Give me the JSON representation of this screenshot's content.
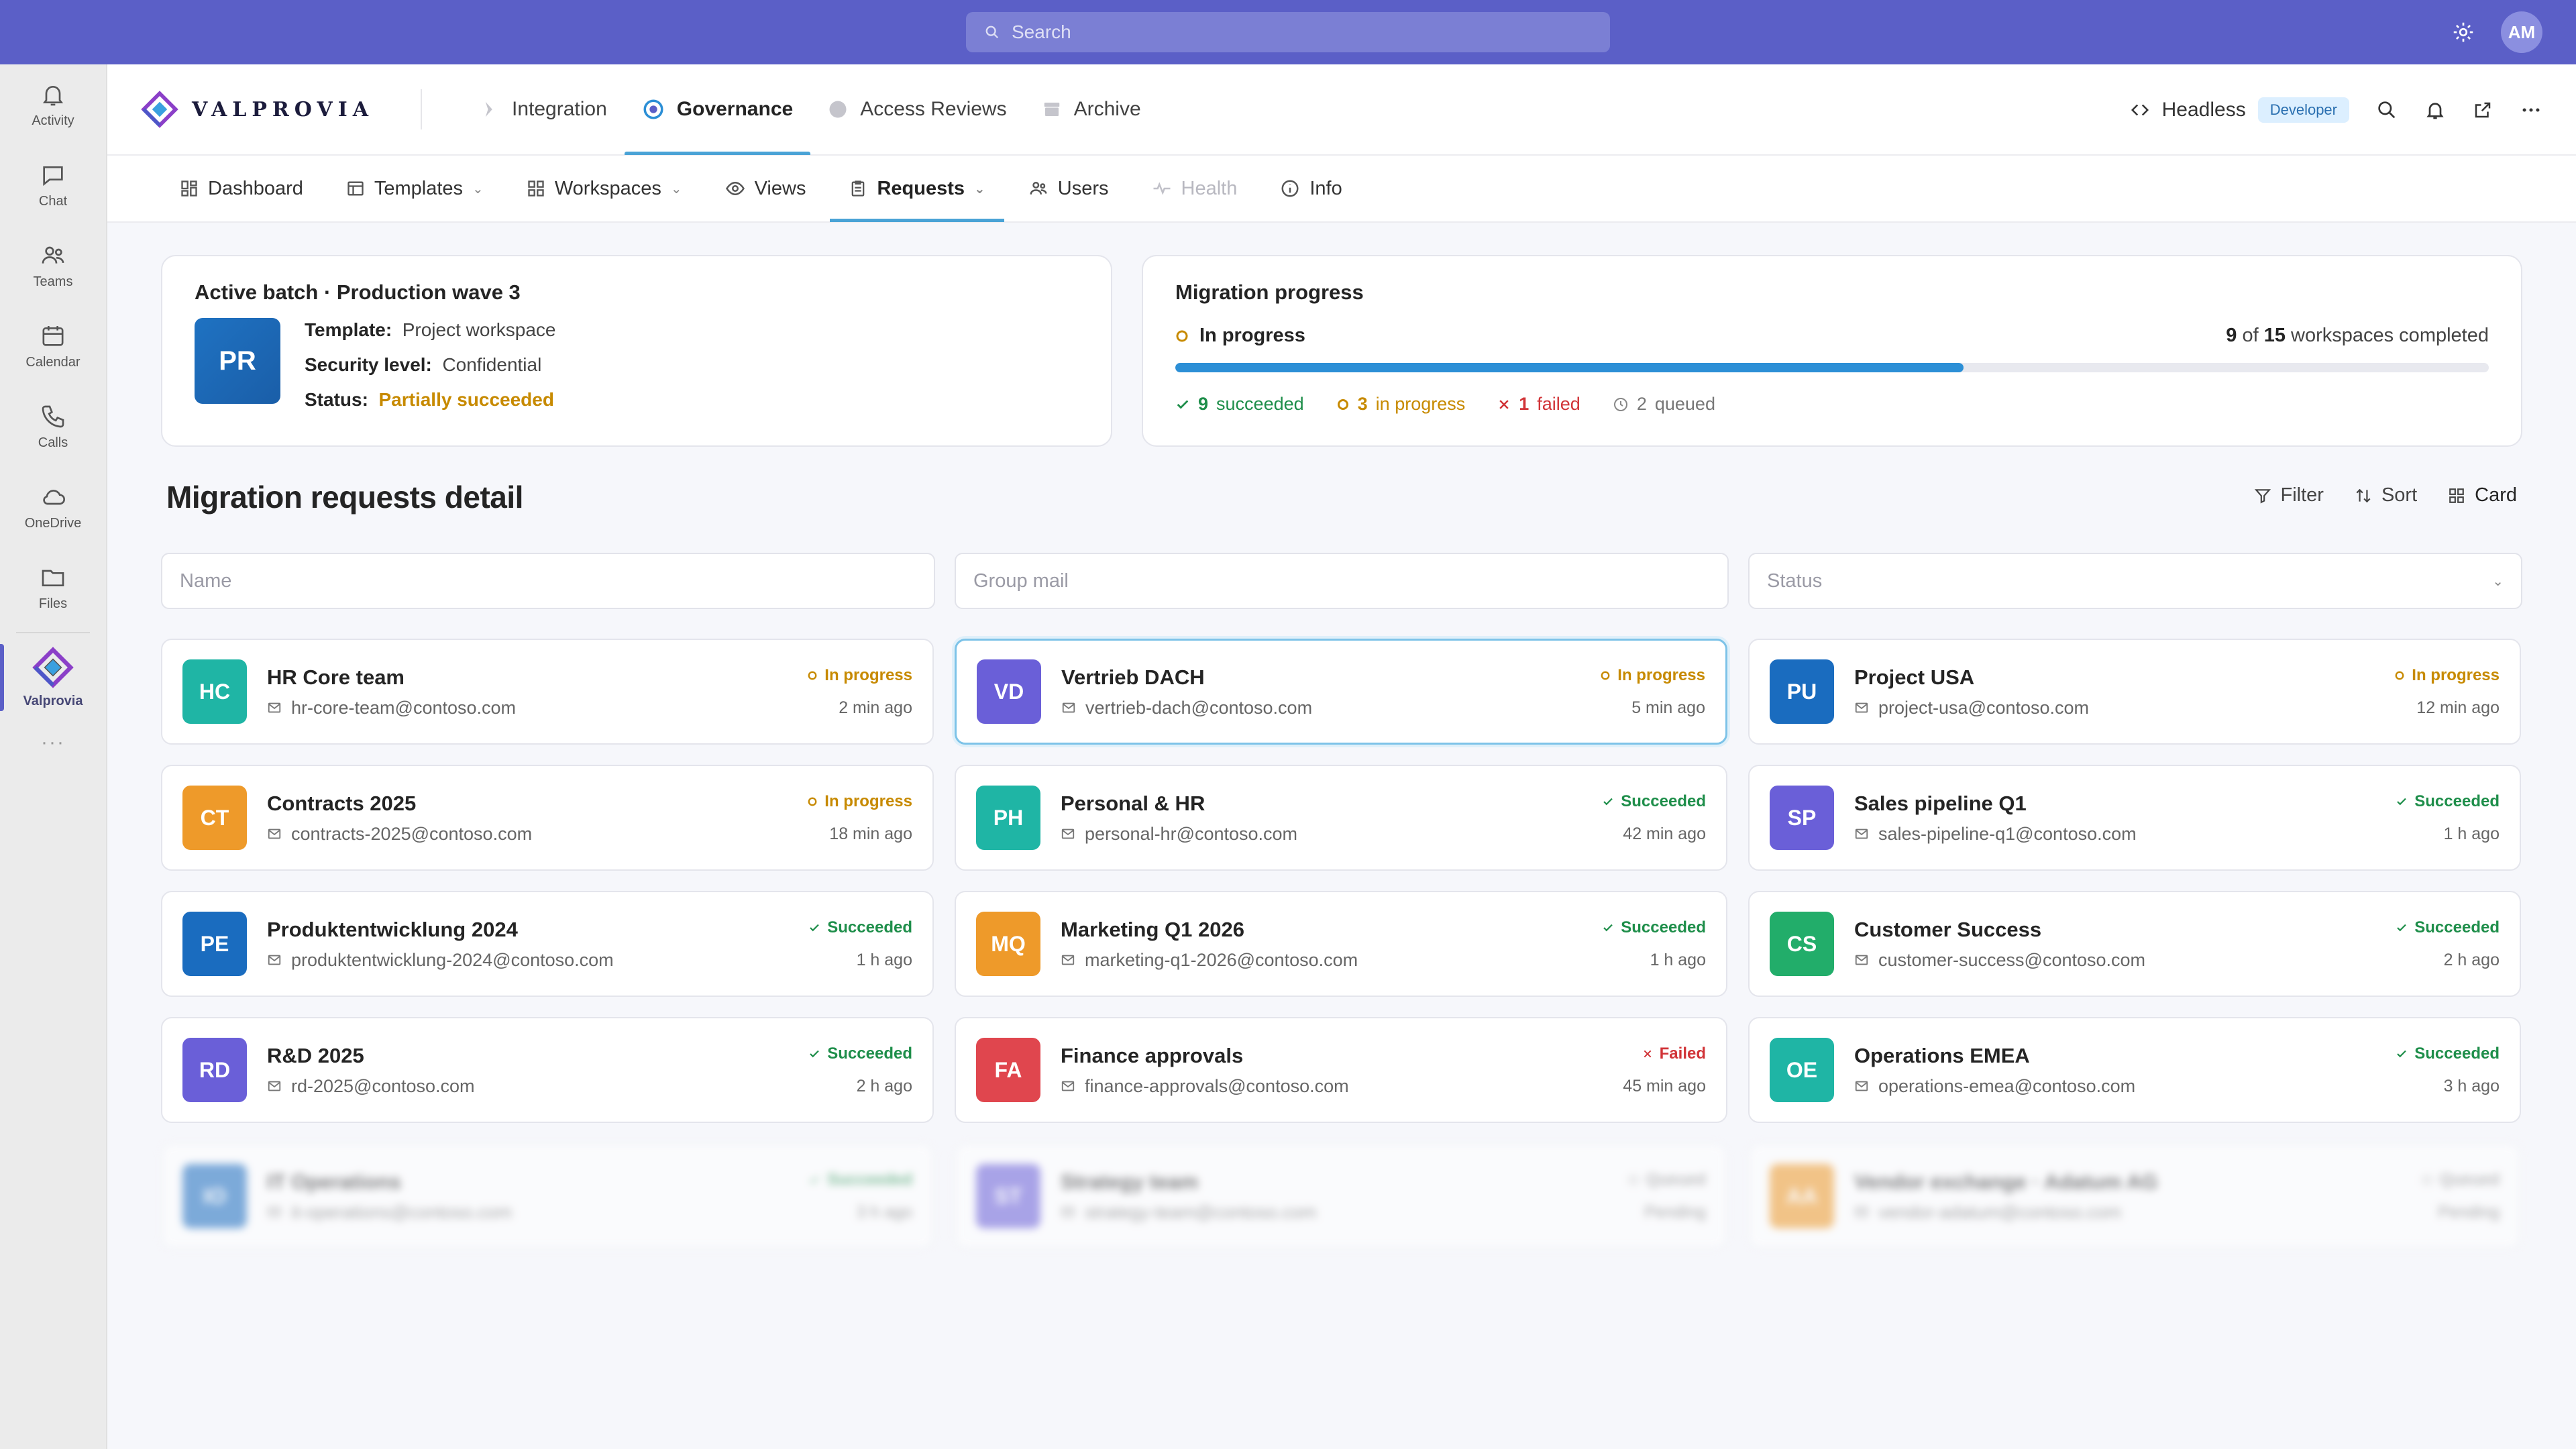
{
  "topbar": {
    "search_placeholder": "Search",
    "user_initials": "AM"
  },
  "rail": {
    "items": [
      {
        "label": "Activity",
        "icon": "bell-icon"
      },
      {
        "label": "Chat",
        "icon": "chat-icon"
      },
      {
        "label": "Teams",
        "icon": "teams-icon"
      },
      {
        "label": "Calendar",
        "icon": "calendar-icon"
      },
      {
        "label": "Calls",
        "icon": "phone-icon"
      },
      {
        "label": "OneDrive",
        "icon": "cloud-icon"
      },
      {
        "label": "Files",
        "icon": "folder-icon"
      }
    ],
    "active_app": "Valprovia",
    "more": "···"
  },
  "appbar": {
    "logo_text": "VALPROVIA",
    "tabs": [
      {
        "label": "Integration",
        "icon": "integration-icon"
      },
      {
        "label": "Governance",
        "icon": "governance-icon",
        "active": true
      },
      {
        "label": "Access Reviews",
        "icon": "shield-icon"
      },
      {
        "label": "Archive",
        "icon": "archive-icon"
      }
    ],
    "headless": "Headless",
    "developer_badge": "Developer"
  },
  "subtabs": [
    {
      "label": "Dashboard",
      "icon": "dashboard-icon"
    },
    {
      "label": "Templates",
      "icon": "templates-icon",
      "dropdown": true
    },
    {
      "label": "Workspaces",
      "icon": "workspaces-icon",
      "dropdown": true
    },
    {
      "label": "Views",
      "icon": "eye-icon"
    },
    {
      "label": "Requests",
      "icon": "clipboard-icon",
      "dropdown": true,
      "active": true
    },
    {
      "label": "Users",
      "icon": "users-icon"
    },
    {
      "label": "Health",
      "icon": "pulse-icon",
      "disabled": true
    },
    {
      "label": "Info",
      "icon": "info-icon"
    }
  ],
  "batch": {
    "title": "Active batch · Production wave 3",
    "initials": "PR",
    "template_label": "Template:",
    "template_value": "Project workspace",
    "security_label": "Security level:",
    "security_value": "Confidential",
    "status_label": "Status:",
    "status_value": "Partially succeeded"
  },
  "progress": {
    "title": "Migration progress",
    "state": "In progress",
    "completed": "9",
    "of": "of",
    "total": "15",
    "suffix": "workspaces completed",
    "fraction": 0.6,
    "succeeded_count": "9",
    "succeeded_label": "succeeded",
    "inprogress_count": "3",
    "inprogress_label": "in progress",
    "failed_count": "1",
    "failed_label": "failed",
    "queued_count": "2",
    "queued_label": "queued"
  },
  "detail": {
    "title": "Migration requests detail",
    "filter": "Filter",
    "sort": "Sort",
    "view": "Card",
    "name_placeholder": "Name",
    "mail_placeholder": "Group mail",
    "status_placeholder": "Status"
  },
  "colors": {
    "accent": "#5b5fc7",
    "in_progress": "#c78a00",
    "succeeded": "#1e8e4a",
    "failed": "#d13438"
  },
  "requests": [
    {
      "initials": "HC",
      "name": "HR Core team",
      "mail": "hr-core-team@contoso.com",
      "status": "In progress",
      "kind": "inprogress",
      "time": "2 min ago",
      "color": "#1fb5a5"
    },
    {
      "initials": "VD",
      "name": "Vertrieb DACH",
      "mail": "vertrieb-dach@contoso.com",
      "status": "In progress",
      "kind": "inprogress",
      "time": "5 min ago",
      "color": "#6a5fd8"
    },
    {
      "initials": "PU",
      "name": "Project USA",
      "mail": "project-usa@contoso.com",
      "status": "In progress",
      "kind": "inprogress",
      "time": "12 min ago",
      "color": "#1a6cbf"
    },
    {
      "initials": "CT",
      "name": "Contracts 2025",
      "mail": "contracts-2025@contoso.com",
      "status": "In progress",
      "kind": "inprogress",
      "time": "18 min ago",
      "color": "#ee9a2a"
    },
    {
      "initials": "PH",
      "name": "Personal & HR",
      "mail": "personal-hr@contoso.com",
      "status": "Succeeded",
      "kind": "succeeded",
      "time": "42 min ago",
      "color": "#1fb5a5"
    },
    {
      "initials": "SP",
      "name": "Sales pipeline Q1",
      "mail": "sales-pipeline-q1@contoso.com",
      "status": "Succeeded",
      "kind": "succeeded",
      "time": "1 h ago",
      "color": "#6a5fd8"
    },
    {
      "initials": "PE",
      "name": "Produktentwicklung 2024",
      "mail": "produktentwicklung-2024@contoso.com",
      "status": "Succeeded",
      "kind": "succeeded",
      "time": "1 h ago",
      "color": "#1a6cbf"
    },
    {
      "initials": "MQ",
      "name": "Marketing Q1 2026",
      "mail": "marketing-q1-2026@contoso.com",
      "status": "Succeeded",
      "kind": "succeeded",
      "time": "1 h ago",
      "color": "#ee9a2a"
    },
    {
      "initials": "CS",
      "name": "Customer Success",
      "mail": "customer-success@contoso.com",
      "status": "Succeeded",
      "kind": "succeeded",
      "time": "2 h ago",
      "color": "#22ad6a"
    },
    {
      "initials": "RD",
      "name": "R&D 2025",
      "mail": "rd-2025@contoso.com",
      "status": "Succeeded",
      "kind": "succeeded",
      "time": "2 h ago",
      "color": "#6a5fd8"
    },
    {
      "initials": "FA",
      "name": "Finance approvals",
      "mail": "finance-approvals@contoso.com",
      "status": "Failed",
      "kind": "failed",
      "time": "45 min ago",
      "color": "#e0464e"
    },
    {
      "initials": "OE",
      "name": "Operations EMEA",
      "mail": "operations-emea@contoso.com",
      "status": "Succeeded",
      "kind": "succeeded",
      "time": "3 h ago",
      "color": "#1fb5a5"
    },
    {
      "initials": "IO",
      "name": "IT Operations",
      "mail": "it-operations@contoso.com",
      "status": "Succeeded",
      "kind": "succeeded",
      "time": "3 h ago",
      "color": "#1a6cbf"
    },
    {
      "initials": "ST",
      "name": "Strategy team",
      "mail": "strategy-team@contoso.com",
      "status": "Queued",
      "kind": "queued",
      "time": "Pending",
      "color": "#6a5fd8"
    },
    {
      "initials": "AA",
      "name": "Vendor exchange · Adatum AG",
      "mail": "vendor-adatum@contoso.com",
      "status": "Queued",
      "kind": "queued",
      "time": "Pending",
      "color": "#ee9a2a"
    }
  ]
}
